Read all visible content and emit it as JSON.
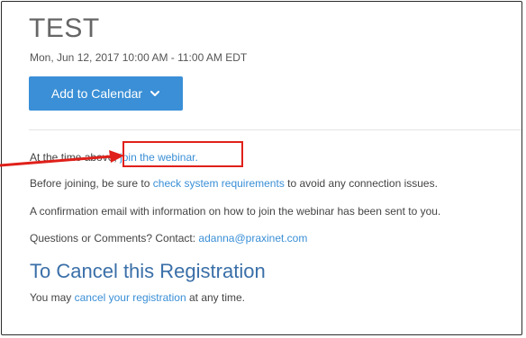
{
  "event": {
    "title": "TEST",
    "datetime": "Mon, Jun 12, 2017 10:00 AM - 11:00 AM EDT",
    "add_to_calendar_label": "Add to Calendar"
  },
  "info": {
    "line1_prefix": "At the time above, ",
    "join_link": "join the webinar.",
    "line2_prefix": "Before joining, be sure to ",
    "system_requirements_link": "check system requirements",
    "line2_suffix": " to avoid any connection issues.",
    "line3": "A confirmation email with information on how to join the webinar has been sent to you.",
    "line4_prefix": "Questions or Comments? Contact: ",
    "contact_email": "adanna@praxinet.com"
  },
  "cancel": {
    "heading": "To Cancel this Registration",
    "prefix": "You may ",
    "link": "cancel your registration",
    "suffix": " at any time."
  },
  "colors": {
    "accent": "#3a8fd6",
    "annotation": "#e0201a"
  },
  "icons": {
    "chevron": "chevron-down-icon",
    "arrow": "annotation-arrow"
  }
}
